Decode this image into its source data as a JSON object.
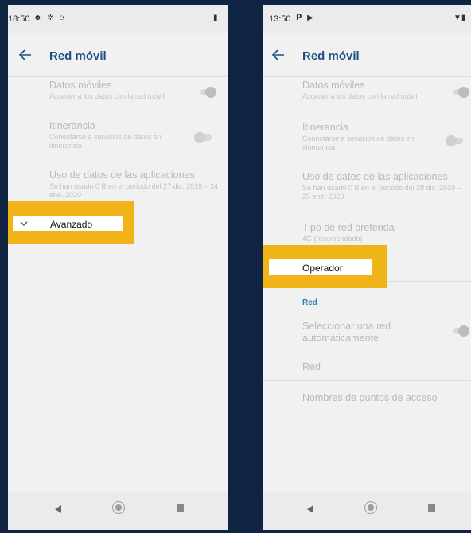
{
  "left": {
    "status": {
      "time": "18:50",
      "icons": "☻ ✲ ℮",
      "battery": "▮"
    },
    "title": "Red móvil",
    "items": [
      {
        "title": "Datos móviles",
        "subtitle": "Acceder a los datos con la red móvil"
      },
      {
        "title": "Itinerancia",
        "subtitle": "Conectarse a servicios de datos en itinerancia"
      },
      {
        "title": "Uso de datos de las aplicaciones",
        "subtitle": "Se han usado 0 B en el periodo del 27 dic. 2019 – 24 ene. 2020"
      }
    ],
    "toggles": {
      "mobile_data": "on",
      "roaming": "off"
    },
    "advanced_label": "Avanzado"
  },
  "right": {
    "status": {
      "time": "13:50",
      "icons": "𝗣 ▶",
      "signal": "▼▮"
    },
    "title": "Red móvil",
    "items": [
      {
        "title": "Datos móviles",
        "subtitle": "Acceder a los datos con la red móvil"
      },
      {
        "title": "Itinerancia",
        "subtitle": "Conectarse a servicios de datos en itinerancia"
      },
      {
        "title": "Uso de datos de las aplicaciones",
        "subtitle": "Se han usado 0 B en el periodo del 28 dic. 2019 – 25 ene. 2020"
      },
      {
        "title": "Tipo de red preferida",
        "subtitle": "4G (recomendado)"
      }
    ],
    "toggles": {
      "mobile_data": "on",
      "roaming": "off",
      "auto_network": "on"
    },
    "operator_label": "Operador",
    "section_red": "Red",
    "auto_select": "Seleccionar una red automáticamente",
    "red_item": "Red",
    "apn": "Nombres de puntos de acceso"
  },
  "colors": {
    "highlight": "#f0b418",
    "accent": "#1d4f86",
    "section": "#2a7fb5",
    "background": "#0f2442"
  },
  "icons": [
    "back-arrow-icon",
    "chevron-down-icon",
    "nav-back-icon",
    "nav-home-icon",
    "nav-recents-icon"
  ]
}
